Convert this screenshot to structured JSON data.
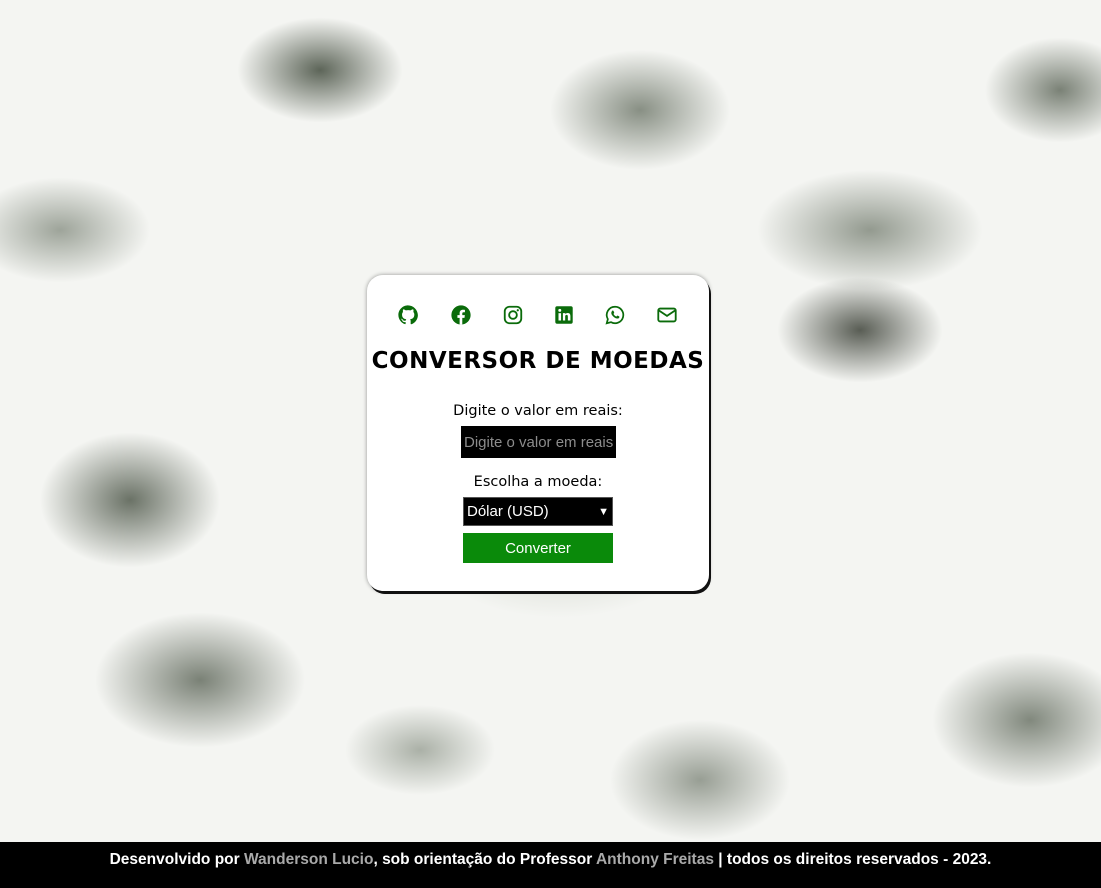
{
  "theme": {
    "accent_green": "#0a8a0a",
    "icon_green": "#0a6b0a",
    "field_background": "#000000",
    "footer_background": "#000000",
    "footer_link_color": "#a9a9a9"
  },
  "social_icons": [
    {
      "name": "github-icon"
    },
    {
      "name": "facebook-icon"
    },
    {
      "name": "instagram-icon"
    },
    {
      "name": "linkedin-icon"
    },
    {
      "name": "whatsapp-icon"
    },
    {
      "name": "email-icon"
    }
  ],
  "converter": {
    "title": "CONVERSOR DE MOEDAS",
    "amount_label": "Digite o valor em reais:",
    "amount_placeholder": "Digite o valor em reais",
    "amount_value": "",
    "currency_label": "Escolha a moeda:",
    "currency_selected": "Dólar (USD)",
    "convert_label": "Converter"
  },
  "footer": {
    "prefix": "Desenvolvido por ",
    "author": "Wanderson Lucio",
    "middle": ", sob orientação do Professor ",
    "professor": "Anthony Freitas",
    "suffix": " | todos os direitos reservados - 2023."
  }
}
